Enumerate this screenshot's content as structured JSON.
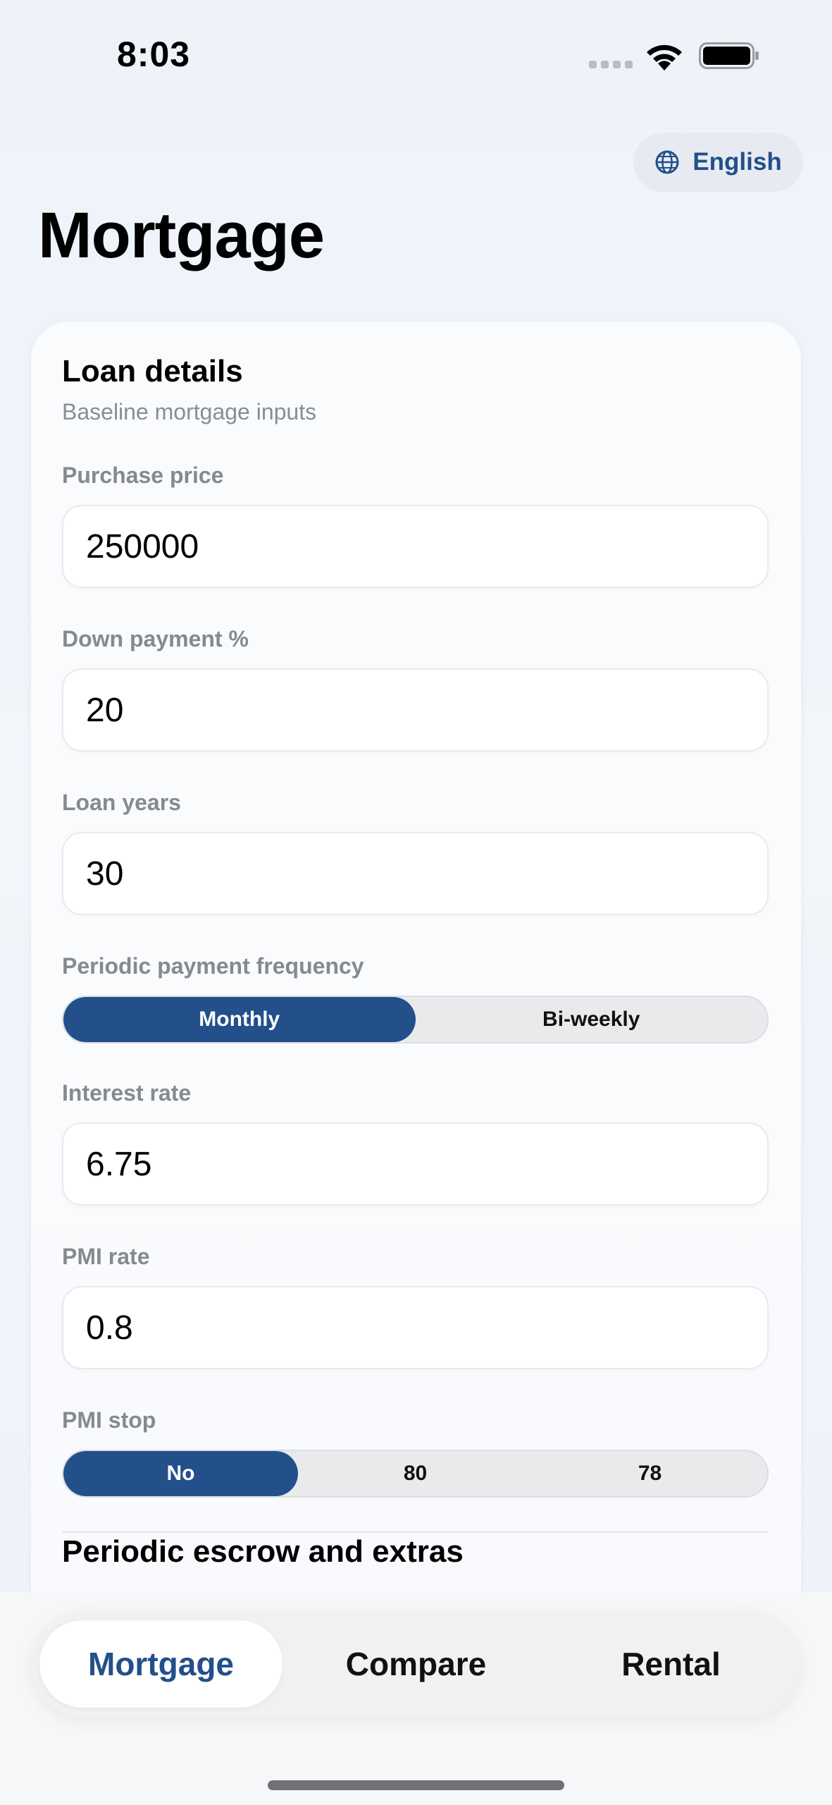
{
  "status_bar": {
    "time": "8:03"
  },
  "language": {
    "label": "English"
  },
  "page_title": "Mortgage",
  "card": {
    "title": "Loan details",
    "subtitle": "Baseline mortgage inputs",
    "fields": {
      "purchase_price": {
        "label": "Purchase price",
        "value": "250000"
      },
      "down_payment": {
        "label": "Down payment %",
        "value": "20"
      },
      "loan_years": {
        "label": "Loan years",
        "value": "30"
      },
      "interest_rate": {
        "label": "Interest rate",
        "value": "6.75"
      },
      "pmi_rate": {
        "label": "PMI rate",
        "value": "0.8"
      }
    },
    "frequency": {
      "label": "Periodic payment frequency",
      "options": [
        "Monthly",
        "Bi-weekly"
      ],
      "selected": "Monthly"
    },
    "pmi_stop": {
      "label": "PMI stop",
      "options": [
        "No",
        "80",
        "78"
      ],
      "selected": "No"
    },
    "next_section_title": "Periodic escrow and extras"
  },
  "tabs": {
    "items": [
      "Mortgage",
      "Compare",
      "Rental"
    ],
    "selected": "Mortgage"
  },
  "colors": {
    "accent": "#234f8b",
    "label_gray": "#86898e",
    "segment_bg": "#e9eaec"
  }
}
